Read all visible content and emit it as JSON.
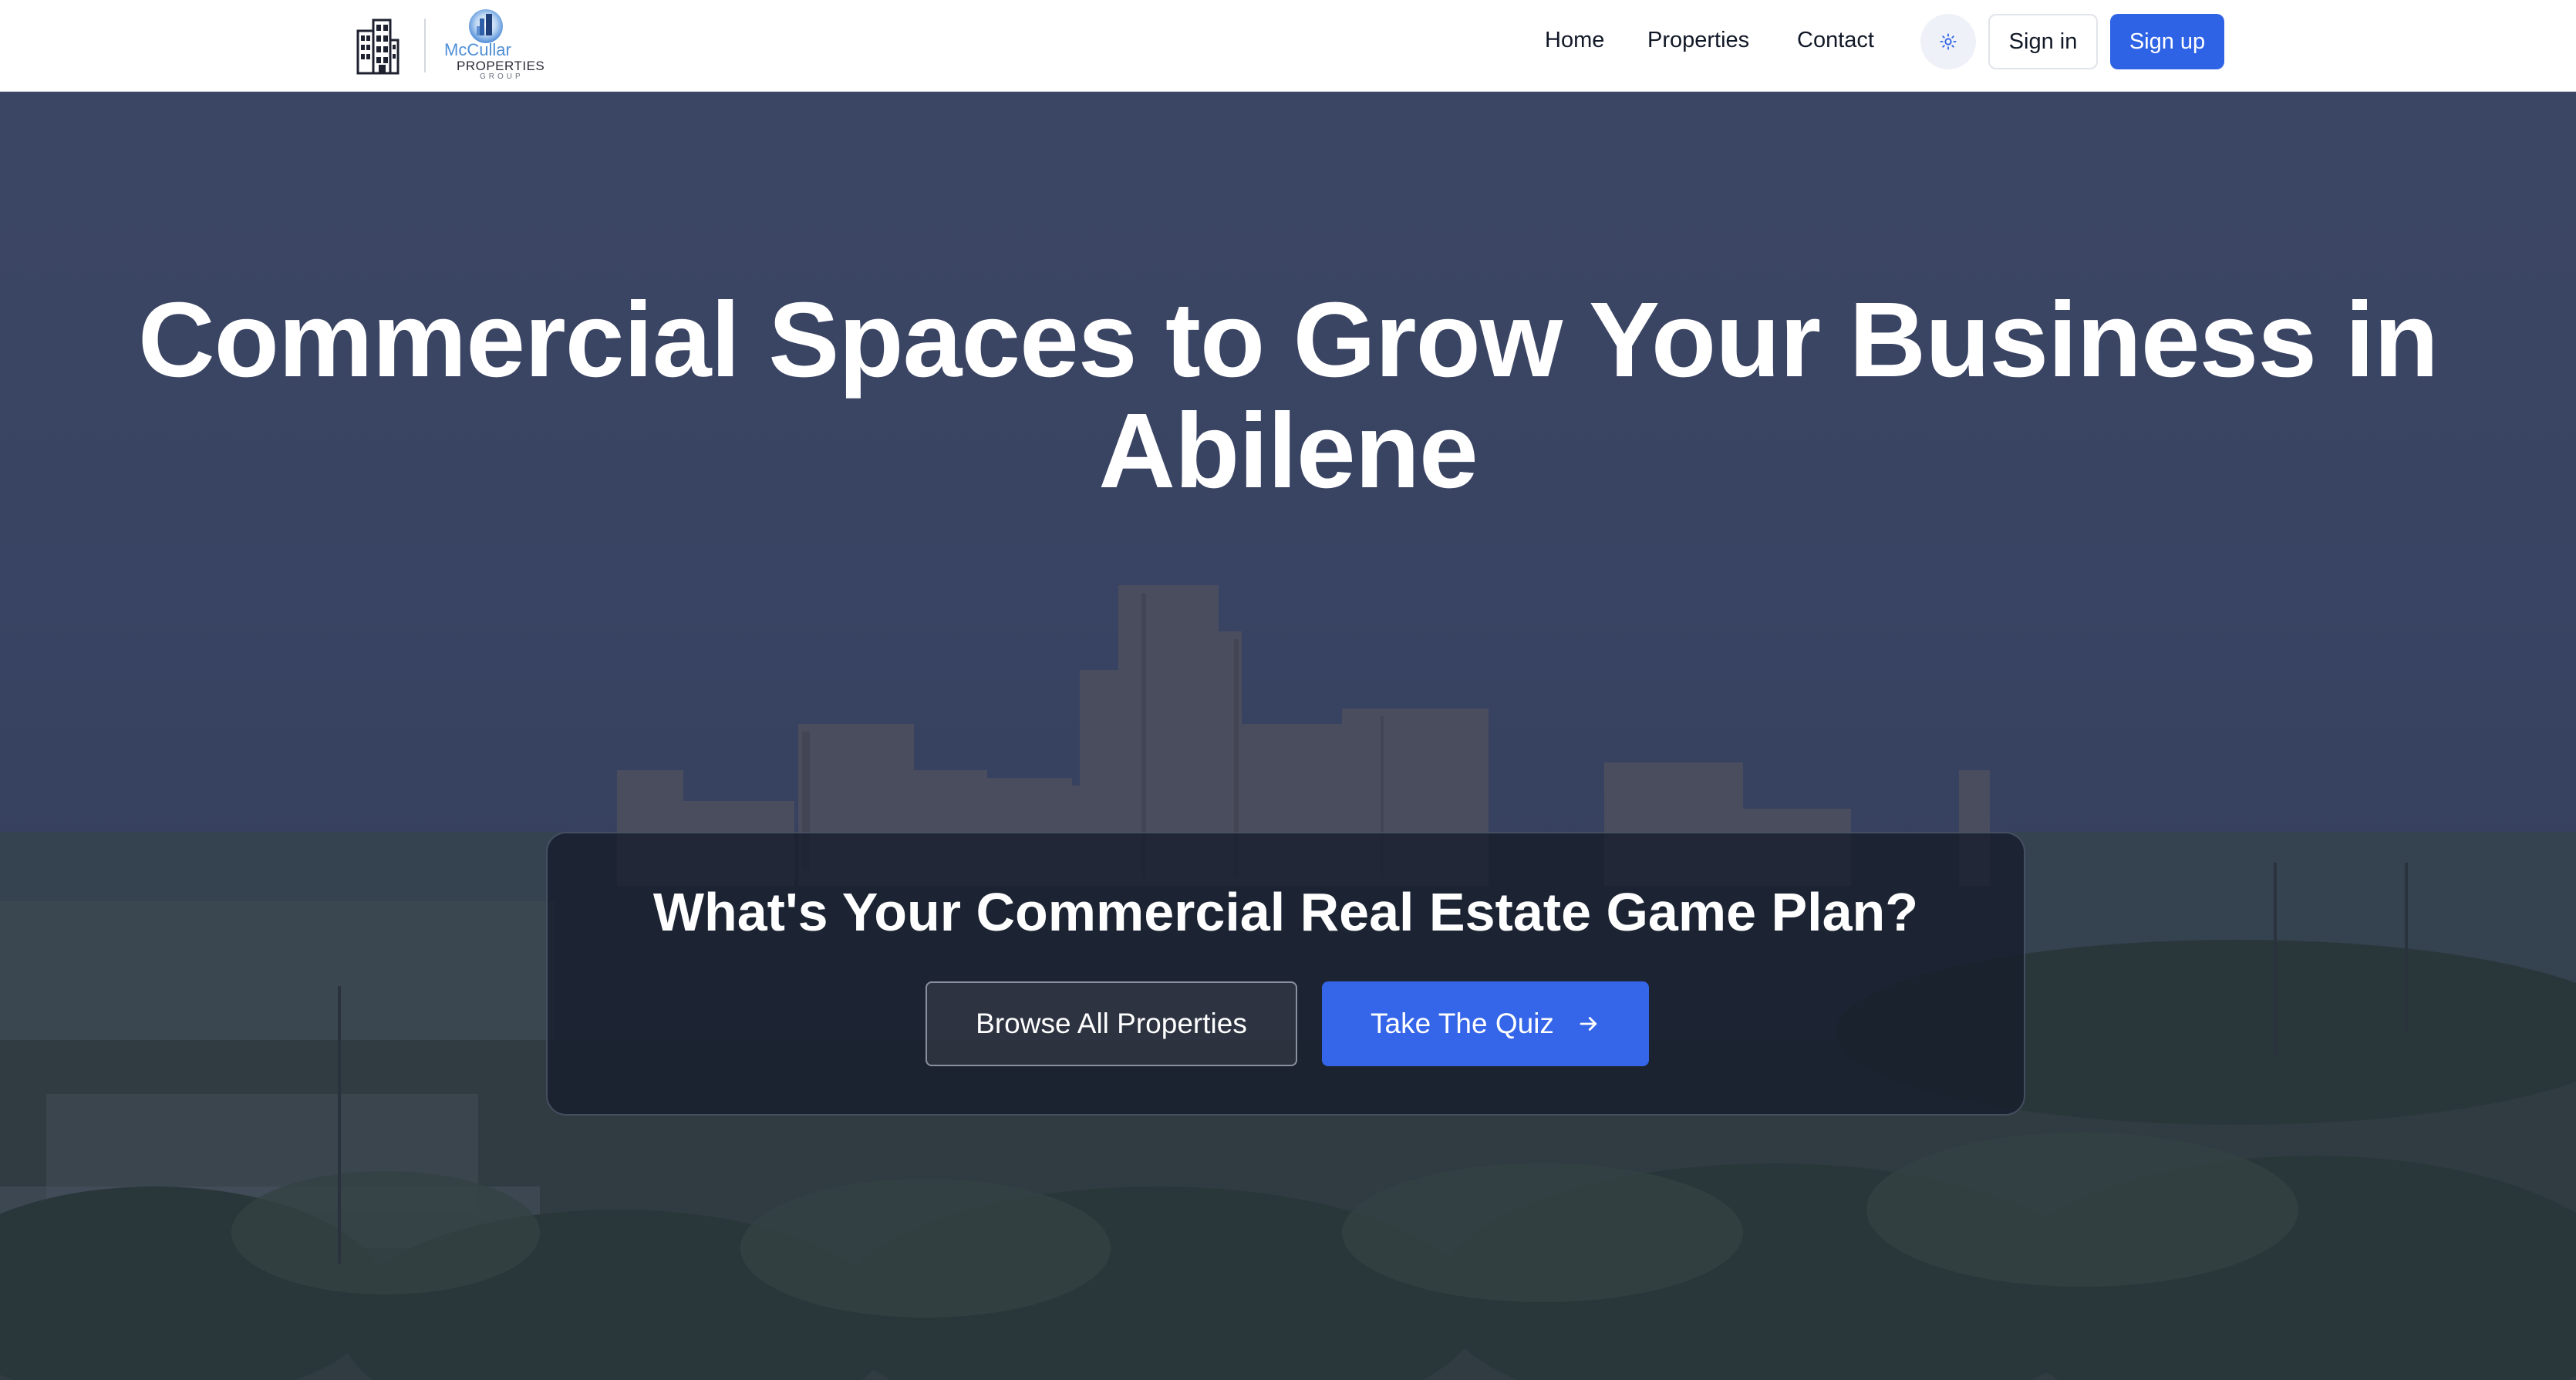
{
  "header": {
    "brand": {
      "logo_line1": "McCullar",
      "logo_line2": "PROPERTIES",
      "logo_line3": "GROUP"
    },
    "nav": [
      {
        "label": "Home"
      },
      {
        "label": "Properties"
      },
      {
        "label": "Contact"
      }
    ],
    "theme_toggle_icon": "sun-icon",
    "sign_in_label": "Sign in",
    "sign_up_label": "Sign up"
  },
  "hero": {
    "title": "Commercial Spaces to Grow Your Business in Abilene",
    "background_image": "abilene-skyline-photo",
    "cta_card": {
      "heading": "What's Your Commercial Real Estate Game Plan?",
      "browse_label": "Browse All Properties",
      "quiz_label": "Take The Quiz",
      "quiz_icon": "arrow-right-icon"
    }
  },
  "colors": {
    "primary": "#2f63e6",
    "header_bg": "#ffffff",
    "hero_overlay": "#3b4766",
    "card_bg": "#161c2c"
  }
}
